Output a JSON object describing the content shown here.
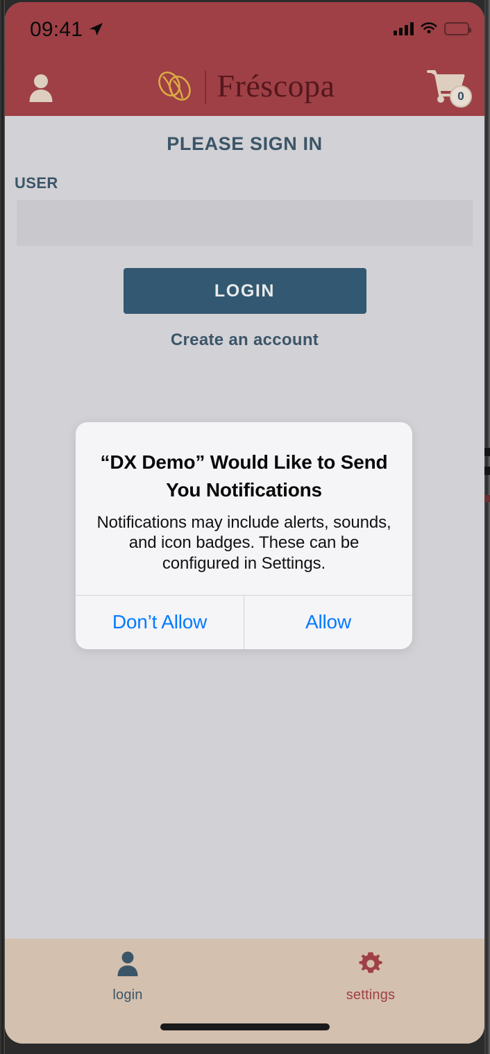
{
  "status_bar": {
    "time": "09:41",
    "location_icon": "location-arrow-icon",
    "signal_icon": "cellular-signal-icon",
    "wifi_icon": "wifi-icon",
    "battery_icon": "battery-full-icon"
  },
  "header": {
    "account_icon": "person-icon",
    "logo_icon": "coffee-beans-icon",
    "brand_name": "Fréscopa",
    "cart_icon": "shopping-cart-icon",
    "cart_badge_count": "0",
    "background_color": "#9e4046",
    "brand_text_color": "#55171c",
    "logo_color": "#dcab42"
  },
  "main": {
    "page_title": "PLEASE SIGN IN",
    "user_field_label": "USER",
    "user_field_value": "",
    "user_field_placeholder": "",
    "login_label": "LOGIN",
    "create_account_label": "Create an account",
    "accent_color": "#3b5568",
    "button_color": "#335871",
    "background_color": "#d2d1d5"
  },
  "alert": {
    "title": "“DX Demo” Would Like to Send You Notifications",
    "message": "Notifications may include alerts, sounds, and icon badges. These can be configured in Settings.",
    "deny_label": "Don’t Allow",
    "allow_label": "Allow",
    "action_color": "#047aff"
  },
  "tab_bar": {
    "background_color": "#d4c0ae",
    "items": [
      {
        "label": "login",
        "icon": "person-icon",
        "color": "#3b5568"
      },
      {
        "label": "settings",
        "icon": "gear-icon",
        "color": "#9e4046"
      }
    ]
  }
}
